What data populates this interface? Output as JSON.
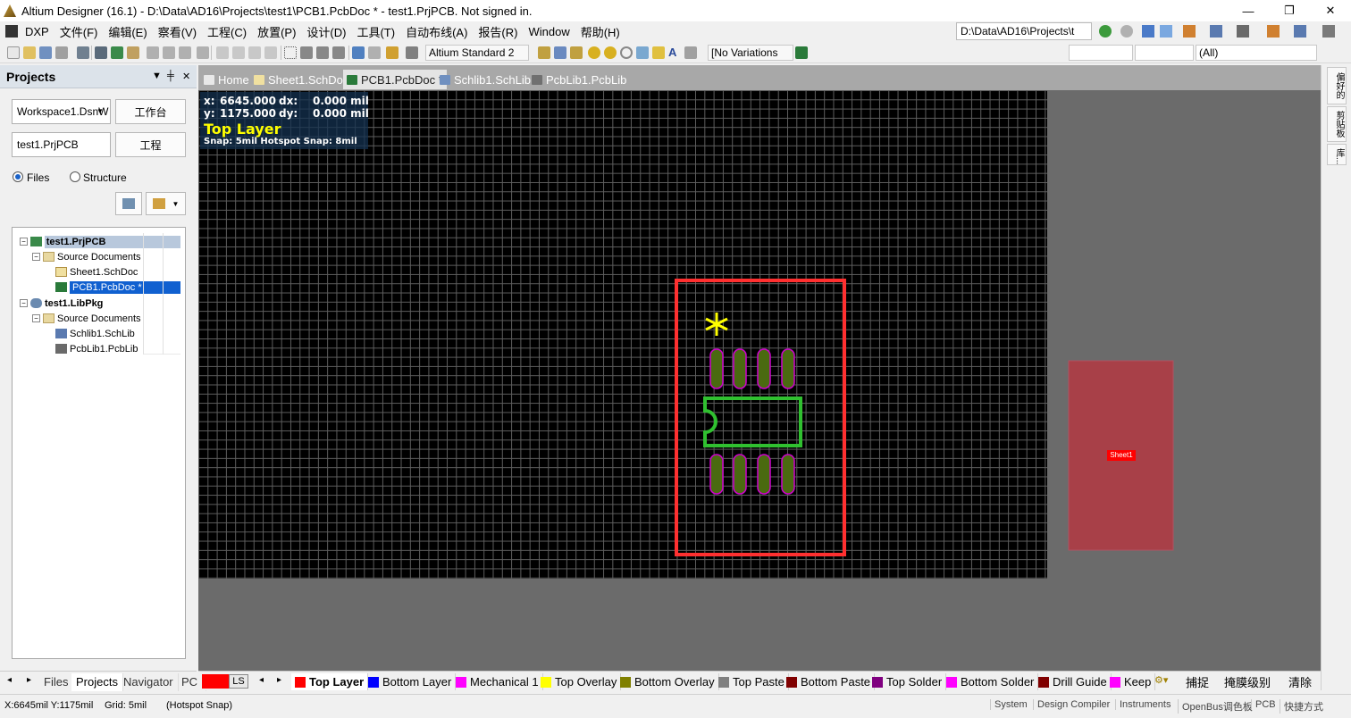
{
  "window": {
    "title": "Altium Designer (16.1) - D:\\Data\\AD16\\Projects\\test1\\PCB1.PcbDoc * - test1.PrjPCB. Not signed in.",
    "min": "—",
    "max": "❐",
    "close": "✕"
  },
  "menu": [
    "DXP",
    "文件(F)",
    "编辑(E)",
    "察看(V)",
    "工程(C)",
    "放置(P)",
    "设计(D)",
    "工具(T)",
    "自动布线(A)",
    "报告(R)",
    "Window",
    "帮助(H)"
  ],
  "path_box": "D:\\Data\\AD16\\Projects\\t",
  "toolbar": {
    "standard_combo": "Altium Standard 2",
    "variations_combo": "[No Variations",
    "filter_combo": "(All)"
  },
  "projects_panel": {
    "title": "Projects",
    "workspace_field": "Workspace1.DsnW",
    "workspace_button": "工作台",
    "project_field": "test1.PrjPCB",
    "project_button": "工程",
    "radio_files": "Files",
    "radio_structure": "Structure",
    "tree": [
      {
        "label": "test1.PrjPCB",
        "level": 0,
        "bold": true,
        "highlight": "grey"
      },
      {
        "label": "Source Documents",
        "level": 1
      },
      {
        "label": "Sheet1.SchDoc",
        "level": 2
      },
      {
        "label": "PCB1.PcbDoc *",
        "level": 2,
        "highlight": "blue"
      },
      {
        "label": "test1.LibPkg",
        "level": 0,
        "bold": true
      },
      {
        "label": "Source Documents",
        "level": 1
      },
      {
        "label": "Schlib1.SchLib",
        "level": 2
      },
      {
        "label": "PcbLib1.PcbLib",
        "level": 2
      }
    ],
    "bottom_tabs": [
      "Files",
      "Projects",
      "Navigator",
      "PCI"
    ]
  },
  "doc_tabs": [
    "Home",
    "Sheet1.SchDoc",
    "PCB1.PcbDoc *",
    "Schlib1.SchLib",
    "PcbLib1.PcbLib"
  ],
  "hud": {
    "x_label": "x:",
    "x_value": "6645.000",
    "dx_label": "dx:",
    "dx_value": "0.000 mil",
    "y_label": "y:",
    "y_value": "1175.000",
    "dy_label": "dy:",
    "dy_value": "0.000 mil",
    "layer": "Top Layer",
    "snap": "Snap: 5mil Hotspot Snap: 8mil"
  },
  "sheet_label": "Sheet1",
  "right_tabs": [
    "偏好的",
    "剪贴板",
    "库..."
  ],
  "layer_bar": {
    "ls": "LS",
    "layers": [
      {
        "name": "Top Layer",
        "color": "#ff0000"
      },
      {
        "name": "Bottom Layer",
        "color": "#0000ff"
      },
      {
        "name": "Mechanical 1",
        "color": "#ff00ff"
      },
      {
        "name": "Top Overlay",
        "color": "#ffff00"
      },
      {
        "name": "Bottom Overlay",
        "color": "#808000"
      },
      {
        "name": "Top Paste",
        "color": "#808080"
      },
      {
        "name": "Bottom Paste",
        "color": "#800000"
      },
      {
        "name": "Top Solder",
        "color": "#800080"
      },
      {
        "name": "Bottom Solder",
        "color": "#ff00ff"
      },
      {
        "name": "Drill Guide",
        "color": "#800000"
      },
      {
        "name": "Keep",
        "color": "#ff00ff"
      }
    ],
    "right_items": [
      "捕捉",
      "掩膜级别",
      "清除"
    ]
  },
  "status": {
    "coords": "X:6645mil Y:1175mil",
    "grid": "Grid: 5mil",
    "snap": "(Hotspot Snap)",
    "buttons": [
      "System",
      "Design Compiler",
      "Instruments",
      "OpenBus调色板",
      "PCB",
      "快捷方式"
    ]
  }
}
